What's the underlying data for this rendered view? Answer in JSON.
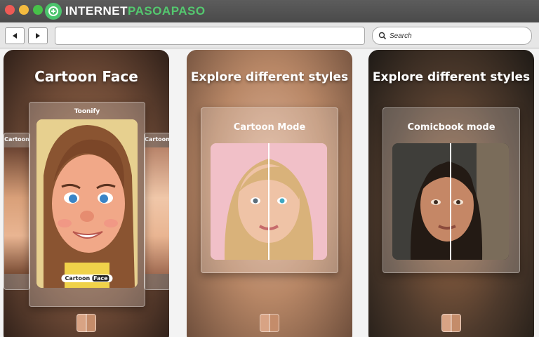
{
  "window": {
    "brand": {
      "prefix": "INTERNET",
      "accent": "PASOAPASO"
    },
    "traffic_lights": [
      "#ee5a55",
      "#f4bb3f",
      "#47c149"
    ]
  },
  "toolbar": {
    "back_icon": "arrow-left-icon",
    "forward_icon": "arrow-right-icon",
    "url": "",
    "search_placeholder": "Search"
  },
  "cards": [
    {
      "title": "Cartoon Face",
      "panel_label": "Toonify",
      "left_side_label": "Cartoon",
      "right_side_label": "Cartoon",
      "badge_prefix": "Cartoon",
      "badge_suffix": "Face"
    },
    {
      "title": "Explore different styles",
      "panel_label": "Cartoon Mode"
    },
    {
      "title": "Explore different styles",
      "panel_label": "Comicbook mode"
    }
  ]
}
